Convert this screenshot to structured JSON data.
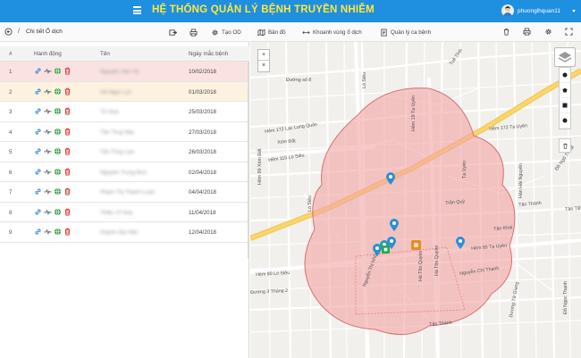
{
  "header": {
    "title": "HỆ THỐNG QUẢN LÝ BỆNH TRUYỀN NHIỄM",
    "username": "phuonglhquan11"
  },
  "left_panel": {
    "breadcrumb_sep": "/",
    "breadcrumb": "Chi tiết Ổ dịch",
    "create_button": "Tạo OD",
    "columns": {
      "num": "#",
      "actions": "Hành động",
      "name": "Tên",
      "date": "Ngày mắc bệnh"
    },
    "rows": [
      {
        "num": "1",
        "name": "Nguyễn Văn Vũ",
        "date": "10/02/2018"
      },
      {
        "num": "2",
        "name": "Hà Ngọc Lợi",
        "date": "01/03/2018"
      },
      {
        "num": "3",
        "name": "Tô Hoà",
        "date": "25/03/2018"
      },
      {
        "num": "4",
        "name": "Tần Thuỳ Mai",
        "date": "27/03/2018"
      },
      {
        "num": "5",
        "name": "Tần Thùy Lan",
        "date": "26/03/2018"
      },
      {
        "num": "6",
        "name": "Nguyễn Trung Đức",
        "date": "02/04/2018"
      },
      {
        "num": "7",
        "name": "Phạm Thị Thanh Loan",
        "date": "04/04/2018"
      },
      {
        "num": "8",
        "name": "Thiều Vĩ Hoa",
        "date": "11/04/2018"
      },
      {
        "num": "9",
        "name": "Huỳnh Gia Hân",
        "date": "12/04/2018"
      }
    ]
  },
  "map_toolbar": {
    "map_button": "Bản đồ",
    "zone_button": "Khoanh vùng ổ dịch",
    "manage_button": "Quản lý ca bệnh"
  },
  "map": {
    "zoom_in": "+",
    "zoom_out": "×",
    "streets": [
      "Đường số 8",
      "Lò Siêu",
      "Tuệ Tĩnh",
      "Hẻm 172 Lạc Long Quân",
      "Hẻm 115 Lò Siêu",
      "Hẻm 172 Tạ Uyên",
      "Hẻm 99 Xóm Đất",
      "Lò Siêu",
      "Tạ Uyên",
      "Hàn Hải Nguyên",
      "Trần Quý",
      "Đề Ngộ Thuật",
      "Tân Thành",
      "Tân Khai",
      "Nguyễn Thị Nhỏ",
      "Hà Tôn Quyền",
      "Hẻm 80 Lò Siêu",
      "Nguyễn Chí Thanh",
      "Đường 3 Tháng 2",
      "Dương Tử Giang",
      "Hẻm 85 Tạ Uyên",
      "Tân Thành",
      "Đỗ Ngọc Thạnh",
      "Hà Tôn Quyền",
      "Tân Tiến",
      "Xóm Đất",
      "Hẻm 19 Tạ Uyên"
    ]
  },
  "colors": {
    "header": "#1f8fe0",
    "title": "#ffe83a",
    "zone_fill": "#f2a6a6",
    "zone_stroke": "#d97070",
    "road_major": "#f9d56e",
    "marker_blue": "#2a8fd4",
    "marker_green": "#2aa84a",
    "marker_orange": "#f08a1c"
  },
  "icons": [
    "menu-icon",
    "back-icon",
    "link-icon",
    "pulse-icon",
    "globe-icon",
    "trash-icon",
    "print-icon",
    "settings-icon",
    "map-icon",
    "layers-icon",
    "fullscreen-icon"
  ]
}
